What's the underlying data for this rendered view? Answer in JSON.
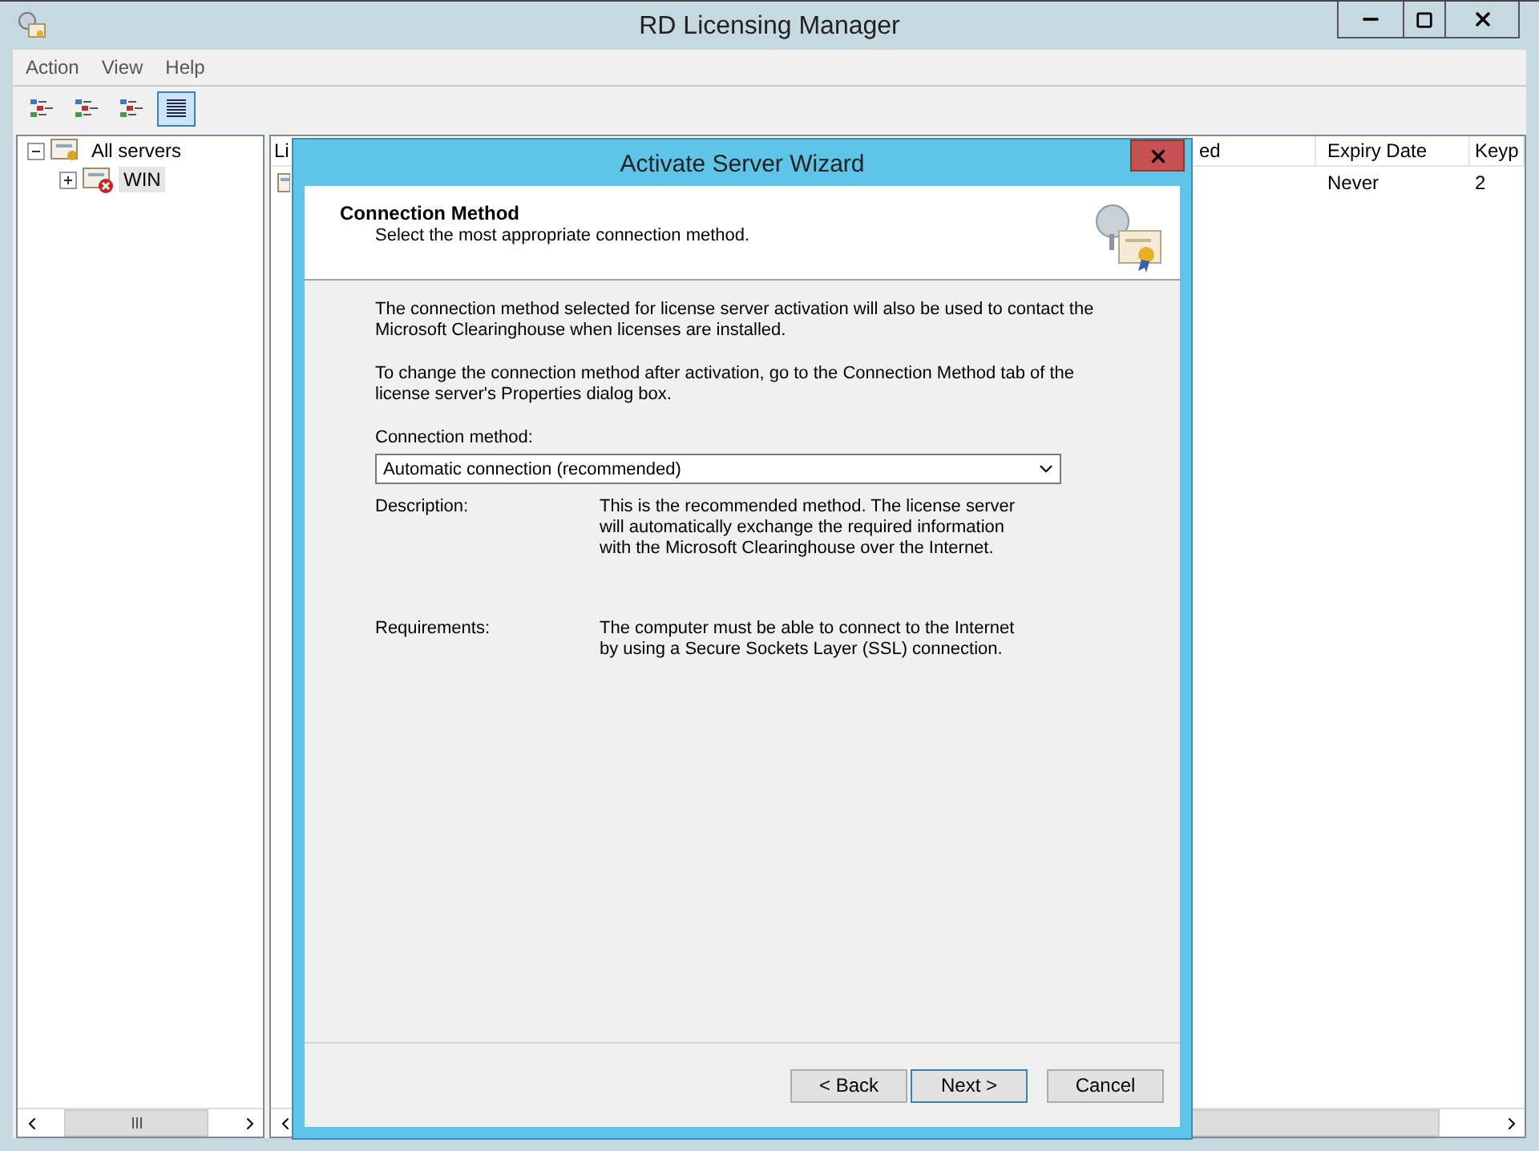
{
  "window": {
    "title": "RD Licensing Manager"
  },
  "menu": [
    "Action",
    "View",
    "Help"
  ],
  "toolbar": [
    {
      "selected": false
    },
    {
      "selected": false
    },
    {
      "selected": false
    },
    {
      "selected": true
    }
  ],
  "tree": [
    {
      "label": "All servers",
      "expanded": true,
      "selected": false,
      "children": [
        {
          "label": "WIN",
          "expanded": false,
          "selected": true,
          "error": true
        }
      ]
    }
  ],
  "list": {
    "columns": [
      "Li",
      "ed",
      "Expiry Date",
      "Keyp"
    ],
    "rows": [
      {
        "column_3": "Never",
        "column_4": "2"
      }
    ]
  },
  "dialog": {
    "title": "Activate Server Wizard",
    "heading": "Connection Method",
    "subheading": "Select the most appropriate connection method.",
    "paragraphs": [
      "The connection method selected for license server activation will also be used to contact the Microsoft Clearinghouse when licenses are installed.",
      "To change the connection method after activation, go to the Connection Method tab of the license server's Properties dialog box."
    ],
    "field_label": "Connection method:",
    "field_value": "Automatic connection (recommended)",
    "details": [
      {
        "label": "Description:",
        "text": "This is the recommended method. The license server will automatically exchange the required information with the Microsoft Clearinghouse over the Internet."
      },
      {
        "label": "Requirements:",
        "text": "The computer must be able to connect to the Internet by using a Secure Sockets Layer (SSL) connection."
      }
    ],
    "buttons": [
      {
        "label": "< Back",
        "default": false
      },
      {
        "label": "Next >",
        "default": true
      },
      {
        "label": "Cancel",
        "default": false
      }
    ]
  }
}
